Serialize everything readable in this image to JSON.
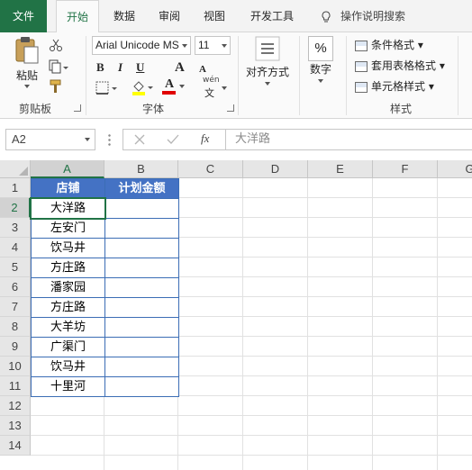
{
  "tabs": [
    "文件",
    "开始",
    "数据",
    "审阅",
    "视图",
    "开发工具"
  ],
  "tell_me": "操作说明搜索",
  "clipboard": {
    "paste": "粘贴",
    "group": "剪贴板"
  },
  "font": {
    "name": "Arial Unicode MS",
    "size": "11",
    "bold": "B",
    "italic": "I",
    "underline": "U",
    "grow": "A",
    "shrink": "A",
    "wen": "wén",
    "wen_char": "文",
    "group": "字体"
  },
  "alignment": {
    "label": "对齐方式"
  },
  "number": {
    "label": "数字",
    "symbol": "%"
  },
  "styles": {
    "conditional": "条件格式",
    "table": "套用表格格式",
    "cell": "单元格样式",
    "group": "样式"
  },
  "formula_bar": {
    "name_box": "A2",
    "fx": "fx",
    "content": "大洋路"
  },
  "columns": [
    "A",
    "B",
    "C",
    "D",
    "E",
    "F",
    "G"
  ],
  "rows": [
    "1",
    "2",
    "3",
    "4",
    "5",
    "6",
    "7",
    "8",
    "9",
    "10",
    "11",
    "12",
    "13",
    "14"
  ],
  "table": {
    "headers": [
      "店铺",
      "计划金额"
    ],
    "stores": [
      "大洋路",
      "左安门",
      "饮马井",
      "方庄路",
      "潘家园",
      "方庄路",
      "大羊坊",
      "广渠门",
      "饮马井",
      "十里河"
    ]
  },
  "colors": {
    "accent": "#217346",
    "table_header": "#4472c4",
    "table_border": "#3b6db5",
    "font_color": "#e00000",
    "highlight": "#ffff00"
  }
}
